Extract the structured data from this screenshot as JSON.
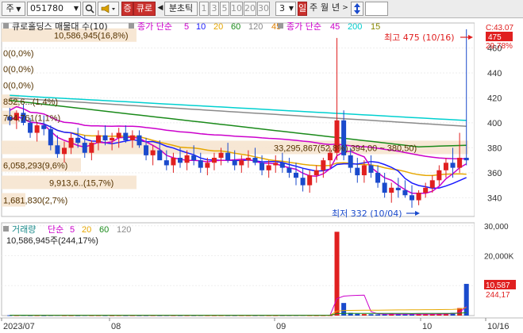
{
  "toolbar": {
    "market_label": "주",
    "stock_code": "051780",
    "search_icon": "magnifier-icon",
    "speaker_icon": "speaker-icon",
    "ticker_badge": "증",
    "ticker_name": "큐로",
    "period_label": "분초틱",
    "period_numbers": [
      "1",
      "3",
      "5",
      "10",
      "20",
      "30"
    ],
    "interval_value": "3",
    "daily_label": "일",
    "week_label": "주",
    "month_label": "월",
    "year_label": "년",
    "sort_icon": "updown-arrow-icon"
  },
  "price_panel": {
    "title": "큐로홀딩스 매물대 수(10)",
    "ma_label": "종가 단순",
    "ma_periods": [
      "5",
      "10",
      "20",
      "60",
      "120",
      "45"
    ],
    "ma_colors": [
      "#cc00cc",
      "#1a1aff",
      "#e6a700",
      "#1a8a1a",
      "#8a8a8a",
      "#e08000"
    ],
    "ma2_label": "종가 단순",
    "ma2_periods": [
      "45",
      "200",
      "15"
    ],
    "ma2_colors": [
      "#cc00cc",
      "#00cccc",
      "#888800"
    ],
    "high_label": "최고 475 (10/16)",
    "low_label": "최저 332 (10/04)",
    "current_price": "475",
    "top_right_label": "C:43.07",
    "second_right_label": "29.78%",
    "volume_profile": [
      {
        "label": "10,586,945(16,8%)"
      },
      {
        "label": "0(0,0%)"
      },
      {
        "label": "0(0,0%)"
      },
      {
        "label": "0(0,0%)"
      },
      {
        "label": "852,6...(1,4%)"
      },
      {
        "label": "704,761(1,1%)"
      },
      {
        "label": "33,295,867(52,8%) 394,00 ~ 380,50)"
      },
      {
        "label": "6,058,293(9,6%)"
      },
      {
        "label": "9,913,6..(15,7%)"
      },
      {
        "label": "1,681,830(2,7%)"
      }
    ],
    "y_ticks": [
      "460",
      "440",
      "420",
      "400",
      "380",
      "360",
      "340"
    ]
  },
  "volume_panel": {
    "title": "거래량",
    "ma_label": "단순",
    "ma_periods": [
      "5",
      "20",
      "60",
      "120"
    ],
    "ma_colors": [
      "#cc00cc",
      "#e6a700",
      "#1a8a1a",
      "#8a8a8a"
    ],
    "last_volume": "10,586,945주(244,17%)",
    "y_ticks": [
      "30,000",
      "20,000K",
      "10,000"
    ],
    "last_value_badge": "10,587",
    "last_pct_badge": "244,17"
  },
  "x_axis": {
    "labels": [
      "2023/07",
      "08",
      "09",
      "10",
      "10/16"
    ]
  },
  "chart_data": {
    "type": "candlestick",
    "title": "큐로홀딩스",
    "dates_note": "2023/07 - 10/16 daily",
    "ohlc": [
      [
        405,
        412,
        398,
        402
      ],
      [
        402,
        410,
        395,
        408
      ],
      [
        408,
        415,
        398,
        400
      ],
      [
        400,
        404,
        388,
        392
      ],
      [
        392,
        400,
        385,
        398
      ],
      [
        398,
        406,
        390,
        395
      ],
      [
        395,
        398,
        378,
        382
      ],
      [
        382,
        390,
        372,
        375
      ],
      [
        375,
        385,
        368,
        380
      ],
      [
        380,
        392,
        375,
        388
      ],
      [
        388,
        396,
        380,
        384
      ],
      [
        384,
        390,
        372,
        376
      ],
      [
        376,
        386,
        370,
        384
      ],
      [
        384,
        394,
        378,
        390
      ],
      [
        390,
        398,
        382,
        386
      ],
      [
        386,
        392,
        378,
        388
      ],
      [
        388,
        396,
        380,
        392
      ],
      [
        392,
        398,
        384,
        386
      ],
      [
        386,
        394,
        380,
        390
      ],
      [
        390,
        394,
        380,
        382
      ],
      [
        382,
        388,
        370,
        374
      ],
      [
        374,
        382,
        366,
        378
      ],
      [
        378,
        386,
        372,
        370
      ],
      [
        370,
        378,
        362,
        366
      ],
      [
        366,
        376,
        360,
        372
      ],
      [
        372,
        380,
        364,
        368
      ],
      [
        368,
        378,
        362,
        374
      ],
      [
        374,
        382,
        366,
        370
      ],
      [
        370,
        376,
        360,
        364
      ],
      [
        364,
        372,
        358,
        368
      ],
      [
        368,
        376,
        362,
        372
      ],
      [
        372,
        380,
        366,
        376
      ],
      [
        376,
        384,
        368,
        370
      ],
      [
        370,
        378,
        362,
        366
      ],
      [
        366,
        374,
        360,
        370
      ],
      [
        370,
        378,
        364,
        372
      ],
      [
        372,
        380,
        366,
        368
      ],
      [
        368,
        374,
        358,
        362
      ],
      [
        362,
        370,
        356,
        366
      ],
      [
        366,
        374,
        360,
        368
      ],
      [
        368,
        376,
        360,
        364
      ],
      [
        364,
        372,
        356,
        360
      ],
      [
        360,
        368,
        350,
        356
      ],
      [
        356,
        364,
        345,
        350
      ],
      [
        350,
        362,
        344,
        358
      ],
      [
        358,
        366,
        352,
        362
      ],
      [
        362,
        372,
        356,
        370
      ],
      [
        370,
        380,
        364,
        376
      ],
      [
        376,
        468,
        370,
        402
      ],
      [
        402,
        410,
        370,
        374
      ],
      [
        374,
        380,
        360,
        364
      ],
      [
        364,
        372,
        352,
        358
      ],
      [
        358,
        370,
        352,
        366
      ],
      [
        366,
        374,
        356,
        360
      ],
      [
        360,
        366,
        348,
        352
      ],
      [
        352,
        360,
        340,
        344
      ],
      [
        344,
        352,
        336,
        348
      ],
      [
        348,
        356,
        340,
        346
      ],
      [
        346,
        354,
        340,
        342
      ],
      [
        342,
        350,
        332,
        338
      ],
      [
        338,
        346,
        334,
        344
      ],
      [
        344,
        352,
        340,
        348
      ],
      [
        348,
        358,
        344,
        354
      ],
      [
        354,
        366,
        350,
        362
      ],
      [
        362,
        372,
        356,
        368
      ],
      [
        368,
        380,
        356,
        364
      ],
      [
        364,
        392,
        360,
        372
      ],
      [
        372,
        475,
        366,
        370
      ]
    ],
    "volumes_k": [
      120,
      110,
      130,
      90,
      100,
      80,
      110,
      140,
      100,
      90,
      85,
      120,
      95,
      100,
      90,
      80,
      100,
      85,
      90,
      80,
      85,
      95,
      80,
      100,
      90,
      85,
      90,
      80,
      95,
      85,
      80,
      90,
      85,
      80,
      90,
      85,
      80,
      95,
      90,
      85,
      90,
      100,
      110,
      120,
      95,
      85,
      90,
      110,
      28000,
      4200,
      900,
      600,
      500,
      450,
      400,
      500,
      600,
      450,
      400,
      500,
      450,
      400,
      500,
      600,
      700,
      900,
      2500,
      10587
    ],
    "ylim": [
      325,
      480
    ],
    "vol_ylim": [
      0,
      31000
    ]
  }
}
